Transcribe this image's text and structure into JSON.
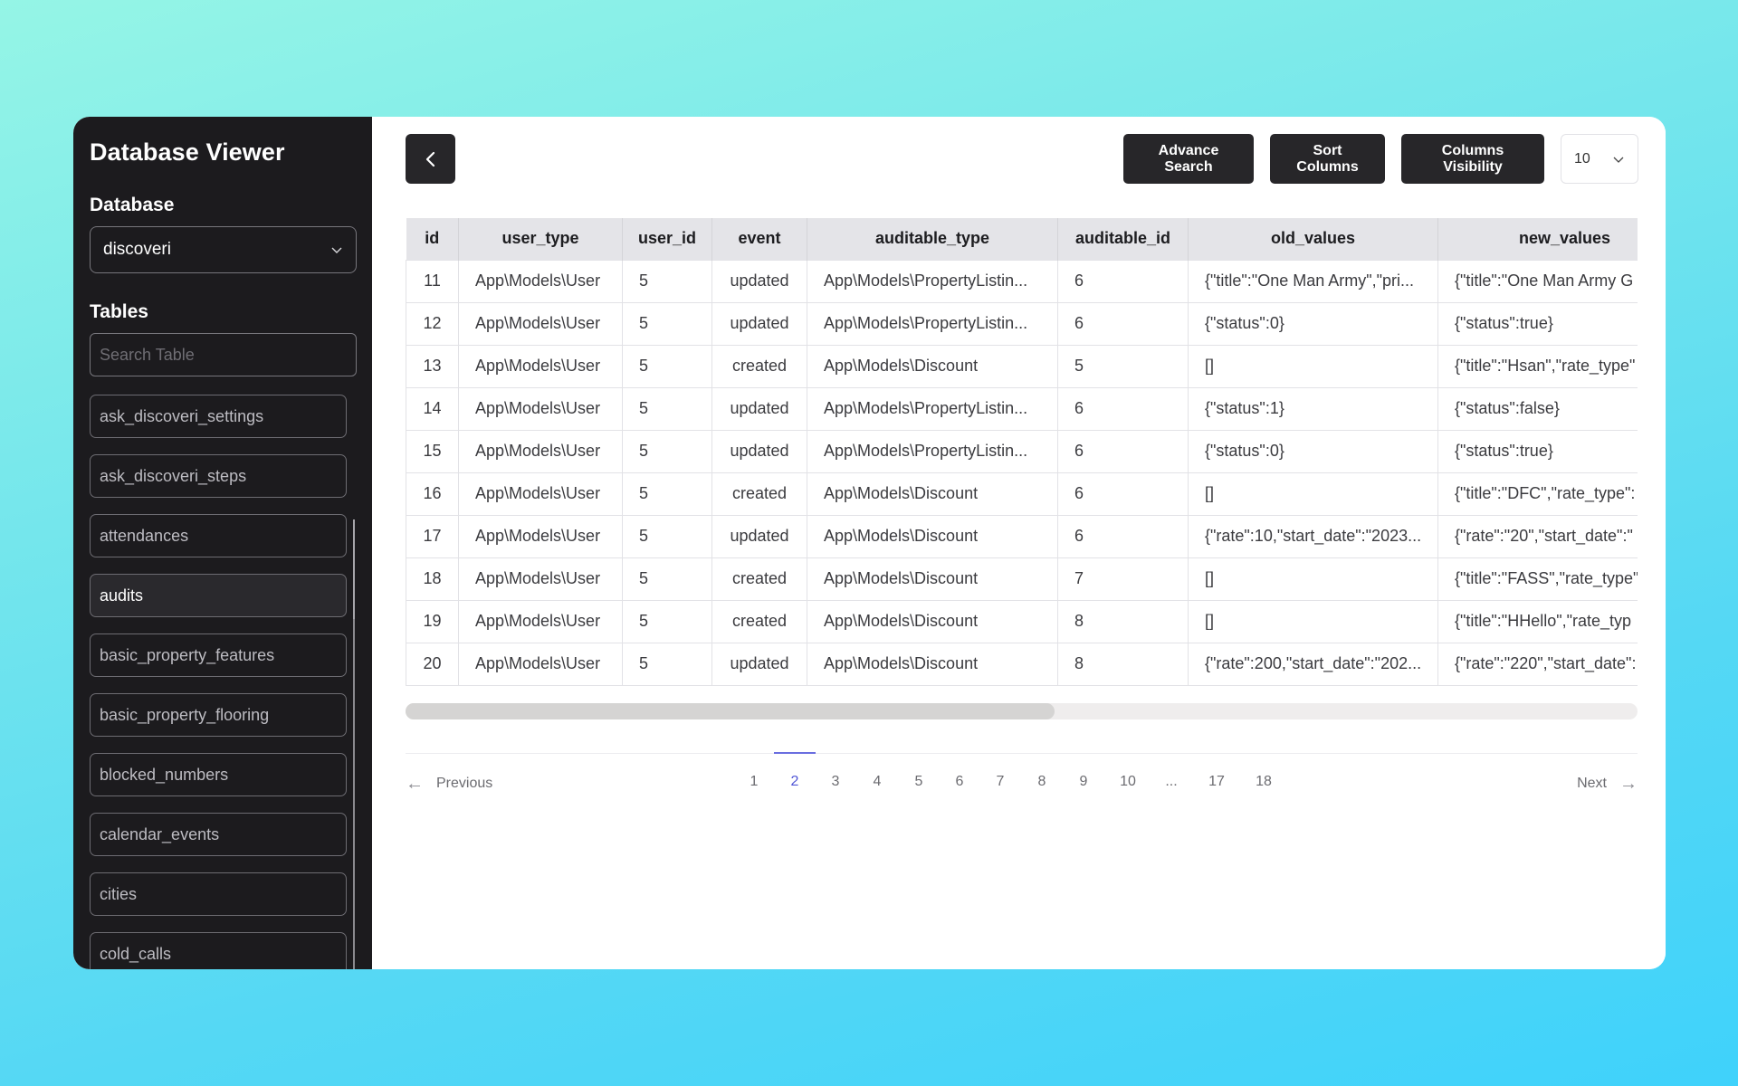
{
  "sidebar": {
    "app_title": "Database Viewer",
    "database_label": "Database",
    "database_selected": "discoveri",
    "tables_label": "Tables",
    "search_placeholder": "Search Table",
    "search_value": "",
    "tables": [
      {
        "label": "ask_discoveri_settings",
        "active": false
      },
      {
        "label": "ask_discoveri_steps",
        "active": false
      },
      {
        "label": "attendances",
        "active": false
      },
      {
        "label": "audits",
        "active": true
      },
      {
        "label": "basic_property_features",
        "active": false
      },
      {
        "label": "basic_property_flooring",
        "active": false
      },
      {
        "label": "blocked_numbers",
        "active": false
      },
      {
        "label": "calendar_events",
        "active": false
      },
      {
        "label": "cities",
        "active": false
      },
      {
        "label": "cold_calls",
        "active": false
      }
    ]
  },
  "toolbar": {
    "back_icon": "chevron-left-icon",
    "advance_search_label": "Advance Search",
    "sort_columns_label": "Sort Columns",
    "columns_visibility_label": "Columns Visibility",
    "per_page_value": "10"
  },
  "table": {
    "columns": [
      "id",
      "user_type",
      "user_id",
      "event",
      "auditable_type",
      "auditable_id",
      "old_values",
      "new_values"
    ],
    "rows": [
      [
        "11",
        "App\\Models\\User",
        "5",
        "updated",
        "App\\Models\\PropertyListin...",
        "6",
        "{\"title\":\"One Man Army\",\"pri...",
        "{\"title\":\"One Man Army G"
      ],
      [
        "12",
        "App\\Models\\User",
        "5",
        "updated",
        "App\\Models\\PropertyListin...",
        "6",
        "{\"status\":0}",
        "{\"status\":true}"
      ],
      [
        "13",
        "App\\Models\\User",
        "5",
        "created",
        "App\\Models\\Discount",
        "5",
        "[]",
        "{\"title\":\"Hsan\",\"rate_type\""
      ],
      [
        "14",
        "App\\Models\\User",
        "5",
        "updated",
        "App\\Models\\PropertyListin...",
        "6",
        "{\"status\":1}",
        "{\"status\":false}"
      ],
      [
        "15",
        "App\\Models\\User",
        "5",
        "updated",
        "App\\Models\\PropertyListin...",
        "6",
        "{\"status\":0}",
        "{\"status\":true}"
      ],
      [
        "16",
        "App\\Models\\User",
        "5",
        "created",
        "App\\Models\\Discount",
        "6",
        "[]",
        "{\"title\":\"DFC\",\"rate_type\":"
      ],
      [
        "17",
        "App\\Models\\User",
        "5",
        "updated",
        "App\\Models\\Discount",
        "6",
        "{\"rate\":10,\"start_date\":\"2023...",
        "{\"rate\":\"20\",\"start_date\":\""
      ],
      [
        "18",
        "App\\Models\\User",
        "5",
        "created",
        "App\\Models\\Discount",
        "7",
        "[]",
        "{\"title\":\"FASS\",\"rate_type\""
      ],
      [
        "19",
        "App\\Models\\User",
        "5",
        "created",
        "App\\Models\\Discount",
        "8",
        "[]",
        "{\"title\":\"HHello\",\"rate_typ"
      ],
      [
        "20",
        "App\\Models\\User",
        "5",
        "updated",
        "App\\Models\\Discount",
        "8",
        "{\"rate\":200,\"start_date\":\"202...",
        "{\"rate\":\"220\",\"start_date\":"
      ]
    ],
    "horizontal_scroll_fraction": 0.0
  },
  "pagination": {
    "previous_label": "Previous",
    "next_label": "Next",
    "current_page": "2",
    "pages": [
      "1",
      "2",
      "3",
      "4",
      "5",
      "6",
      "7",
      "8",
      "9",
      "10",
      "...",
      "17",
      "18"
    ]
  },
  "colors": {
    "sidebar_bg": "#1c1b1e",
    "button_bg": "#272629",
    "accent": "#5156d6",
    "header_bg": "#e4e4e8"
  }
}
